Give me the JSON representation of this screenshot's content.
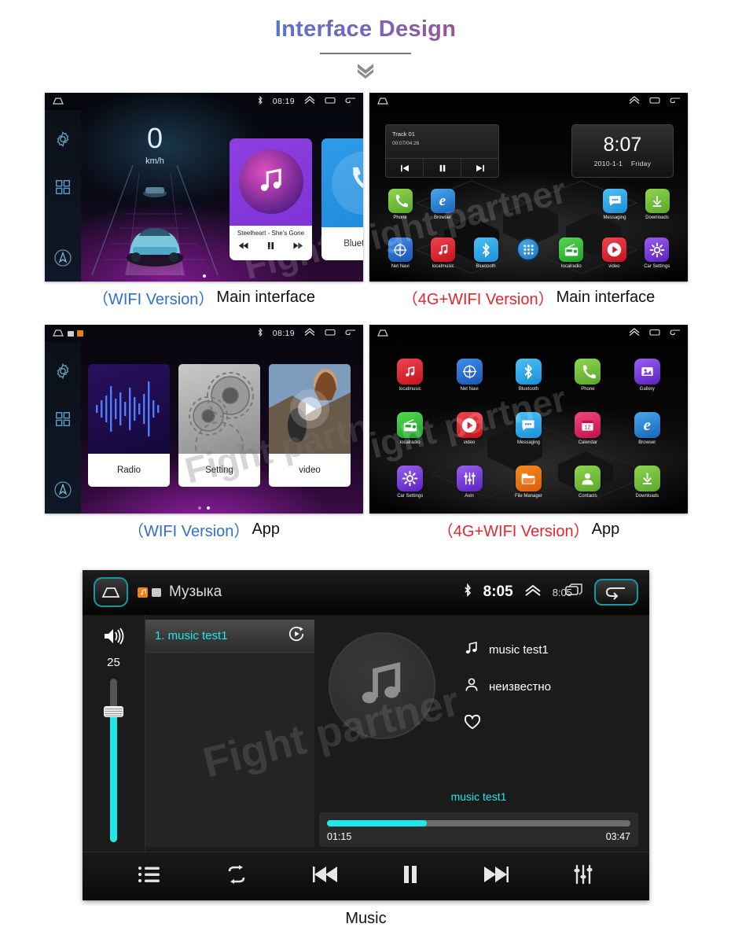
{
  "header": {
    "title": "Interface Design",
    "divider_icon": "double-chevron-down-icon"
  },
  "panels": [
    {
      "id": "wifi-main",
      "caption_version": "（WIFI Version）",
      "caption_version_color": "#2f6fd0",
      "caption_rest": "Main interface",
      "statusbar": {
        "bluetooth": "bluetooth-icon",
        "clock": "08:19",
        "up": "chevron-up-icon",
        "recents": "recents-icon",
        "back": "back-icon"
      },
      "sidebar": [
        "gear-icon",
        "grid-icon",
        "navigation-icon"
      ],
      "speed_value": "0",
      "speed_unit": "km/h",
      "music_card": {
        "title": "Steelheart - She's Gone",
        "prev": "prev-icon",
        "pause": "pause-icon",
        "next": "next-icon"
      },
      "bluetooth_card": {
        "label": "Bluetooth"
      }
    },
    {
      "id": "4g-main",
      "caption_version": "（4G+WIFI Version）",
      "caption_version_color": "#e8242c",
      "caption_rest": "Main interface",
      "statusbar": {
        "clock": "",
        "up": "chevron-up-icon",
        "recents": "recents-icon",
        "back": "back-icon"
      },
      "track_widget": {
        "name": "Track 01",
        "time": "00:07/04:26",
        "prev": "prev-icon",
        "pause": "pause-icon",
        "next": "next-icon"
      },
      "clock_widget": {
        "time": "8:07",
        "date": "2010-1-1",
        "weekday": "Friday"
      },
      "row1": [
        {
          "label": "Phone",
          "icon": "phone-icon",
          "color": "#76c83d"
        },
        {
          "label": "Browser",
          "icon": "browser-icon",
          "color": "#1f7fd0"
        },
        {
          "label": "Messaging",
          "icon": "messaging-icon",
          "color": "#2aa3e8"
        },
        {
          "label": "Downloads",
          "icon": "download-icon",
          "color": "#76c83d"
        }
      ],
      "row2": [
        {
          "label": "Net Navi",
          "icon": "compass-icon",
          "color": "#2a6fd8"
        },
        {
          "label": "localmusic",
          "icon": "music-note-icon",
          "color": "#e01f2b"
        },
        {
          "label": "Bluetooth",
          "icon": "bluetooth-icon",
          "color": "#2aa3e8"
        },
        {
          "label": "",
          "icon": "app-drawer-icon",
          "color": "#2a7fc0"
        },
        {
          "label": "localradio",
          "icon": "radio-icon",
          "color": "#34bb3a"
        },
        {
          "label": "video",
          "icon": "play-circle-icon",
          "color": "#e01f2b"
        },
        {
          "label": "Car Settings",
          "icon": "car-settings-icon",
          "color": "#7a3fd8"
        }
      ]
    },
    {
      "id": "wifi-app",
      "caption_version": "（WIFI Version）",
      "caption_version_color": "#2f6fd0",
      "caption_rest": "App",
      "statusbar": {
        "bluetooth": "bluetooth-icon",
        "clock": "08:19",
        "up": "chevron-up-icon",
        "recents": "recents-icon",
        "back": "back-icon"
      },
      "sidebar": [
        "gear-icon",
        "grid-icon",
        "navigation-icon"
      ],
      "cards": [
        {
          "label": "Radio",
          "thumb": "waveform-thumb"
        },
        {
          "label": "Setting",
          "thumb": "gears-thumb"
        },
        {
          "label": "video",
          "thumb": "movie-thumb"
        }
      ]
    },
    {
      "id": "4g-app",
      "caption_version": "（4G+WIFI Version）",
      "caption_version_color": "#e8242c",
      "caption_rest": "App",
      "statusbar": {
        "up": "chevron-up-icon",
        "recents": "recents-icon",
        "back": "back-icon"
      },
      "apps": [
        {
          "label": "localmusic",
          "icon": "music-note-icon",
          "color": "#e01f2b"
        },
        {
          "label": "Net Navi",
          "icon": "compass-icon",
          "color": "#2a6fd8"
        },
        {
          "label": "Bluetooth",
          "icon": "bluetooth-icon",
          "color": "#2aa3e8"
        },
        {
          "label": "Phone",
          "icon": "phone-icon",
          "color": "#76c83d"
        },
        {
          "label": "Gallery",
          "icon": "gallery-icon",
          "color": "#7a3fd8"
        },
        {
          "label": "localradio",
          "icon": "radio-icon",
          "color": "#34bb3a"
        },
        {
          "label": "video",
          "icon": "play-circle-icon",
          "color": "#e01f2b"
        },
        {
          "label": "Messaging",
          "icon": "messaging-icon",
          "color": "#2aa3e8"
        },
        {
          "label": "Calendar",
          "icon": "calendar-icon",
          "color": "#e0215c"
        },
        {
          "label": "Browser",
          "icon": "browser-icon",
          "color": "#1f7fd0"
        },
        {
          "label": "Car Settings",
          "icon": "car-settings-icon",
          "color": "#7a3fd8"
        },
        {
          "label": "Avin",
          "icon": "sliders-icon",
          "color": "#7a3fd8"
        },
        {
          "label": "File Manager",
          "icon": "folder-icon",
          "color": "#e8721b"
        },
        {
          "label": "Contacts",
          "icon": "contacts-icon",
          "color": "#76c83d"
        },
        {
          "label": "Downloads",
          "icon": "download-icon",
          "color": "#76c83d"
        }
      ]
    }
  ],
  "player": {
    "statusbar": {
      "home": "home-icon",
      "badge_orange": "music-badge-icon",
      "badge_gray": "screen-badge-icon",
      "title": "Музыка",
      "bluetooth": "bluetooth-icon",
      "clock": "8:05",
      "up": "chevron-up-icon",
      "clock2": "8:05",
      "recents": "recents-icon",
      "back": "back-icon"
    },
    "volume": {
      "icon": "volume-icon",
      "value": "25",
      "fill_percent": 80
    },
    "playlist": [
      {
        "label": "1. music test1",
        "action_icon": "play-clock-icon",
        "selected": true
      }
    ],
    "album_icon": "music-note-icon",
    "meta": [
      {
        "icon": "music-note-icon",
        "text": "music test1"
      },
      {
        "icon": "person-icon",
        "text": "неизвестно"
      },
      {
        "icon": "heart-icon",
        "text": ""
      }
    ],
    "now_playing_title": "music test1",
    "progress": {
      "current": "01:15",
      "total": "03:47",
      "percent": 33
    },
    "controls": [
      {
        "name": "playlist-button",
        "icon": "list-icon"
      },
      {
        "name": "repeat-button",
        "icon": "repeat-icon"
      },
      {
        "name": "previous-button",
        "icon": "prev-icon"
      },
      {
        "name": "pause-button",
        "icon": "pause-icon"
      },
      {
        "name": "next-button",
        "icon": "next-icon"
      },
      {
        "name": "equalizer-button",
        "icon": "equalizer-icon"
      }
    ],
    "caption": "Music"
  },
  "watermarks": [
    "Fight Partner",
    "Fight partner",
    "Fight partner"
  ],
  "colors": {
    "accent_cyan": "#21e8e8",
    "blue": "#2f6fd0",
    "red": "#e8242c"
  }
}
